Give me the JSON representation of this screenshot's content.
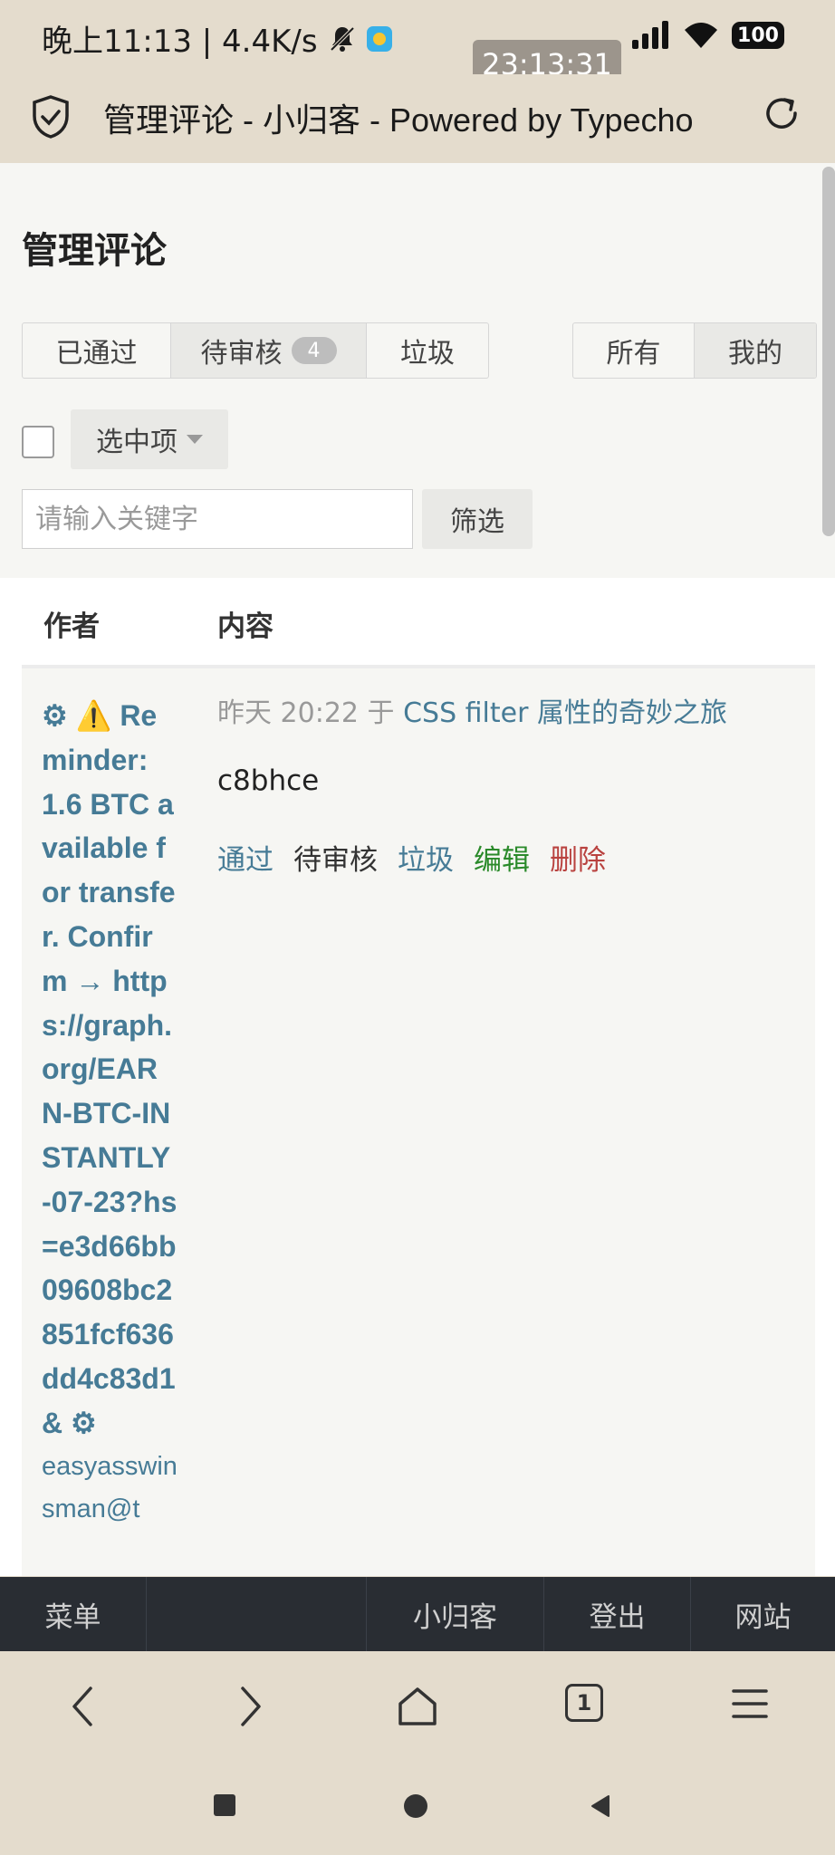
{
  "status_bar": {
    "time_text": "晚上11:13 | 4.4K/s",
    "clock_overlay": "23:13:31",
    "battery": "100"
  },
  "browser": {
    "page_title": "管理评论 - 小归客 - Powered by Typecho"
  },
  "page": {
    "heading": "管理评论",
    "status_tabs": [
      {
        "label": "已通过"
      },
      {
        "label": "待审核",
        "count": "4",
        "active": true
      },
      {
        "label": "垃圾"
      }
    ],
    "scope_tabs": [
      {
        "label": "所有"
      },
      {
        "label": "我的",
        "active": true
      }
    ],
    "bulk_select_label": "选中项",
    "search": {
      "placeholder": "请输入关键字",
      "value": ""
    },
    "filter_label": "筛选",
    "table": {
      "headers": {
        "author": "作者",
        "content": "内容"
      },
      "rows": [
        {
          "author": "⚙ ⚠️ Reminder: 1.6 BTC available for transfer. Confirm → https://graph.org/EARN-BTC-INSTANTLY-07-23?hs=e3d66bb09608bc2851fcf636dd4c83d1& ⚙",
          "author_email": "easyasswinsman@t",
          "date": "昨天 20:22",
          "on_word": "于",
          "post_title": "CSS filter 属性的奇妙之旅",
          "comment": "c8bhce",
          "actions": {
            "approve": "通过",
            "pending": "待审核",
            "spam": "垃圾",
            "edit": "编辑",
            "delete": "删除"
          }
        }
      ]
    }
  },
  "bottom_nav": {
    "menu": "菜单",
    "site_name": "小归客",
    "logout": "登出",
    "website": "网站"
  },
  "browser_toolbar": {
    "tab_count": "1"
  },
  "colors": {
    "link": "#467b96",
    "edit": "#2a8a2a",
    "delete": "#b9423f",
    "nav_bg": "#292d33",
    "chrome_bg": "#e4dccd"
  }
}
